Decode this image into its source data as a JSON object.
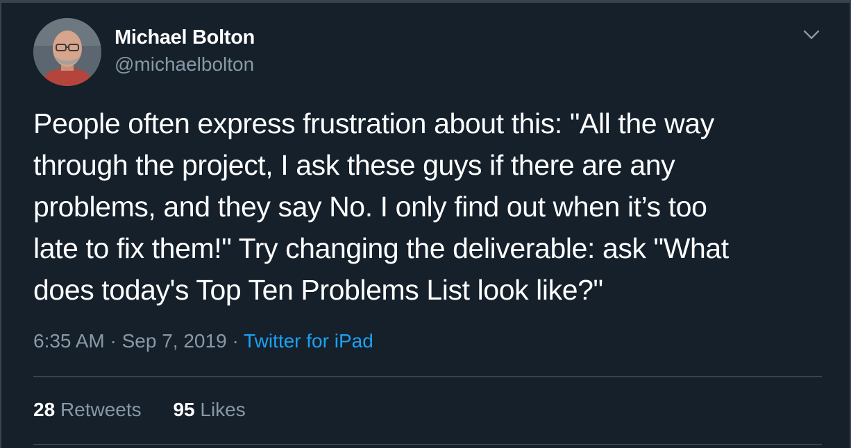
{
  "author": {
    "name": "Michael Bolton",
    "handle": "@michaelbolton"
  },
  "tweet": {
    "text": "People often express frustration about this: \"All the way\nthrough the project, I ask these guys if there are any\nproblems, and they say No. I only find out when it’s too\nlate to fix them!\" Try changing the deliverable: ask \"What\ndoes today's Top Ten Problems List look like?\"",
    "time": "6:35 AM",
    "separator": "·",
    "date": "Sep 7, 2019",
    "source": "Twitter for iPad"
  },
  "stats": {
    "retweets_count": "28",
    "retweets_label": "Retweets",
    "likes_count": "95",
    "likes_label": "Likes"
  },
  "icons": {
    "caret": "chevron-down-icon",
    "avatar": "profile-photo"
  },
  "colors": {
    "background": "#15202b",
    "text_primary": "#ffffff",
    "text_secondary": "#8899a6",
    "accent": "#1da1f2",
    "divider": "#38444d"
  }
}
